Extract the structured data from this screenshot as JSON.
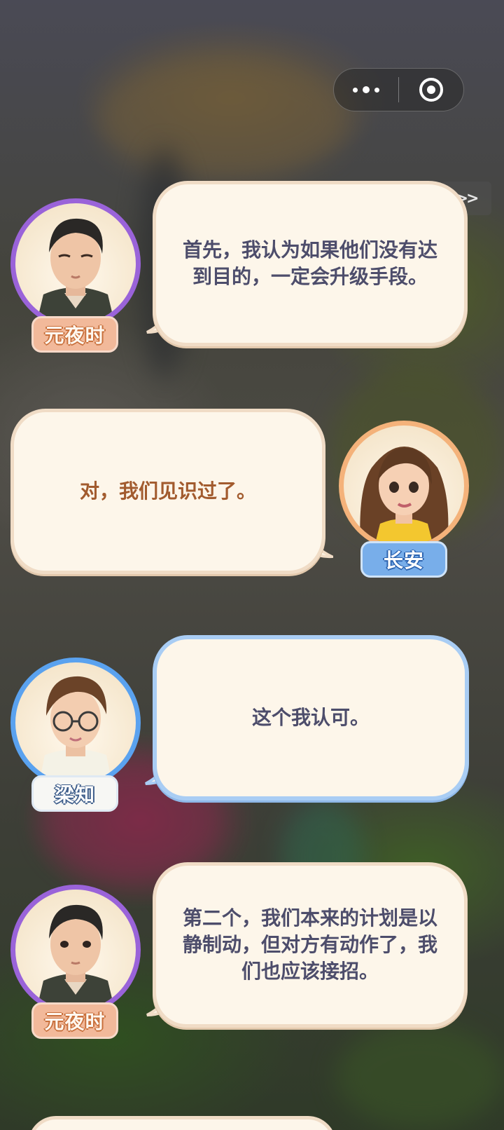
{
  "capsule": {
    "more_icon": "more-dots-icon",
    "close_icon": "target-circle-icon"
  },
  "skip": {
    "label": ">>"
  },
  "dialogue": [
    {
      "speaker": "元夜时",
      "text": "首先，我认为如果他们没有达到目的，一定会升级手段。",
      "side": "left"
    },
    {
      "speaker": "长安",
      "text": "对，我们见识过了。",
      "side": "right"
    },
    {
      "speaker": "梁知",
      "text": "这个我认可。",
      "side": "left"
    },
    {
      "speaker": "元夜时",
      "text": "第二个，我们本来的计划是以静制动，但对方有动作了，我们也应该接招。",
      "side": "left"
    }
  ],
  "colors": {
    "bubble_fill": "#fdf6ea",
    "text_dark": "#4d4d6b",
    "text_brown": "#a25b2e",
    "ring_purple": "#9a63d9",
    "ring_orange": "#f4b27a",
    "ring_blue": "#5aa2ef"
  }
}
